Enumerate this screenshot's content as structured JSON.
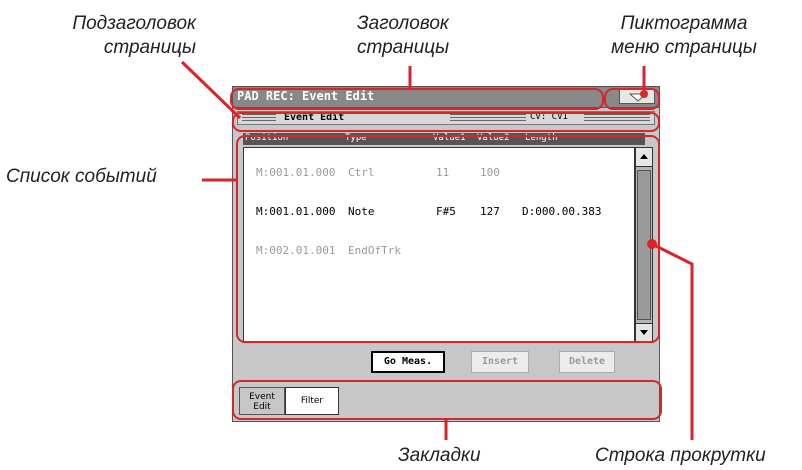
{
  "callouts": {
    "page_subtitle": [
      "Подзаголовок",
      "страницы"
    ],
    "page_title": [
      "Заголовок",
      "страницы"
    ],
    "page_menu_icon": [
      "Пиктограмма",
      "меню страницы"
    ],
    "event_list": "Список событий",
    "tabs": "Закладки",
    "scroll_bar": "Строка прокрутки"
  },
  "titlebar": {
    "title": "PAD REC: Event Edit"
  },
  "subbar": {
    "title": "Event Edit",
    "right": "CV: CV1"
  },
  "columns": [
    "Position",
    "Type",
    "Value1",
    "Value2",
    "Length"
  ],
  "events": [
    {
      "position": "M:001.01.000",
      "type": "Ctrl",
      "value1": "11",
      "value2": "100",
      "length": "",
      "dim": true
    },
    {
      "position": "M:001.01.000",
      "type": "Note",
      "value1": "F#5",
      "value2": "127",
      "length": "D:000.00.383",
      "dim": false
    },
    {
      "position": "M:002.01.001",
      "type": "EndOfTrk",
      "value1": "",
      "value2": "",
      "length": "",
      "dim": true
    }
  ],
  "buttons": {
    "goto": "Go Meas.",
    "insert": "Insert",
    "delete": "Delete"
  },
  "tabs": [
    {
      "label": "Event Edit",
      "selected": true
    },
    {
      "label": "Filter",
      "selected": false
    }
  ],
  "colors": {
    "highlight": "#d8242a",
    "titlebar": "#888888",
    "panel": "#c7c7c7",
    "dim_text": "#9a9a9a"
  }
}
